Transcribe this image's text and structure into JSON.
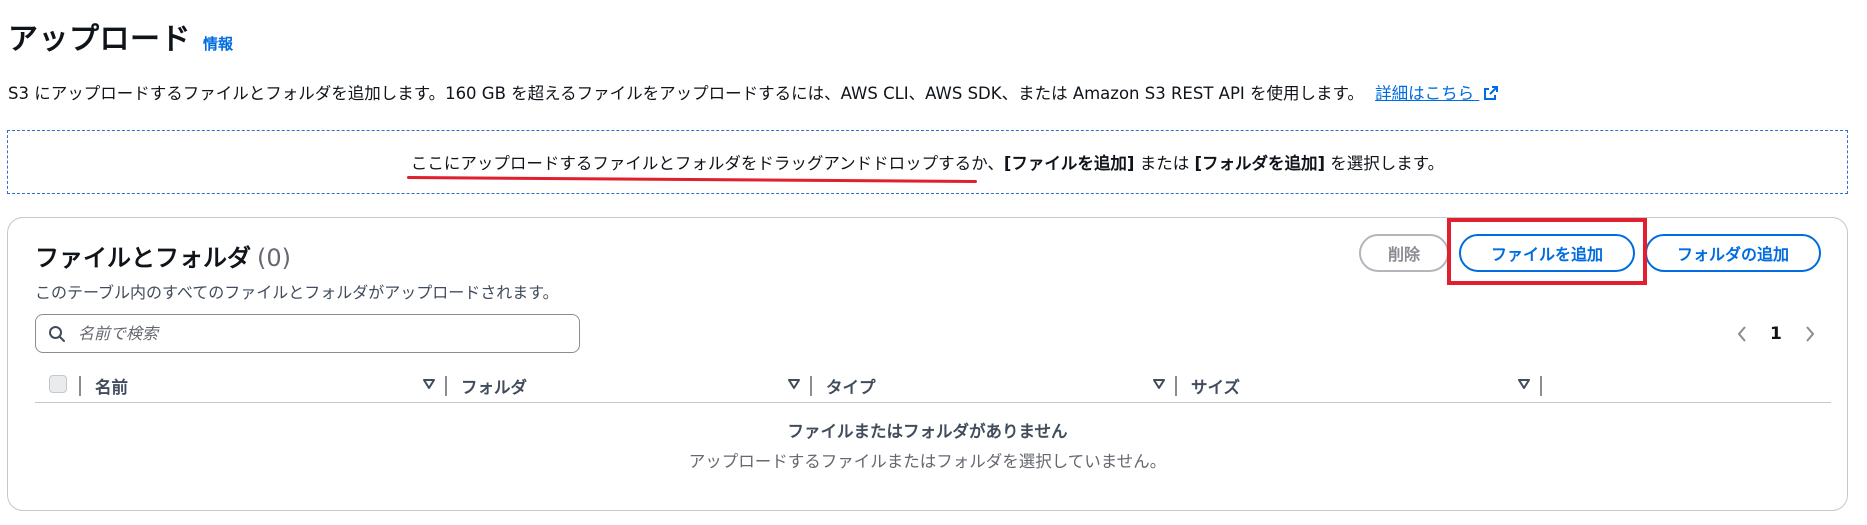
{
  "header": {
    "title": "アップロード",
    "info_label": "情報"
  },
  "description": {
    "text": "S3 にアップロードするファイルとフォルダを追加します。160 GB を超えるファイルをアップロードするには、AWS CLI、AWS SDK、または Amazon S3 REST API を使用します。",
    "link_label": "詳細はこちら"
  },
  "dropzone": {
    "underlined_text": "ここにアップロードするファイルとフォルダをドラッグアンドドロップする",
    "text_1": "か、",
    "bold_1": "[ファイルを追加]",
    "text_2": " または ",
    "bold_2": "[フォルダを追加]",
    "text_3": " を選択します。"
  },
  "files_panel": {
    "title": "ファイルとフォルダ",
    "count": "(0)",
    "description": "このテーブル内のすべてのファイルとフォルダがアップロードされます。",
    "delete_label": "削除",
    "add_files_label": "ファイルを追加",
    "add_folder_label": "フォルダの追加",
    "search_placeholder": "名前で検索",
    "current_page": "1",
    "columns": [
      "名前",
      "フォルダ",
      "タイプ",
      "サイズ"
    ],
    "empty_title": "ファイルまたはフォルダがありません",
    "empty_description": "アップロードするファイルまたはフォルダを選択していません。"
  },
  "colors": {
    "link_blue": "#006ce0",
    "highlight_red": "#e0202e",
    "text_primary": "#0f141a",
    "border_gray": "#c6c6cd"
  },
  "icons": [
    "external-link-icon",
    "search-icon",
    "chevron-left-icon",
    "chevron-right-icon",
    "sort-caret-icon"
  ]
}
